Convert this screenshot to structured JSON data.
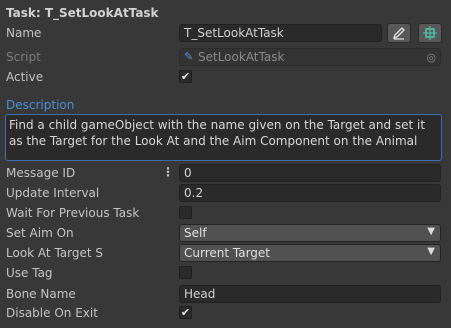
{
  "header": {
    "title": "Task: T_SetLookAtTask"
  },
  "fields": {
    "name": {
      "label": "Name",
      "value": "T_SetLookAtTask"
    },
    "script": {
      "label": "Script",
      "value": "SetLookAtTask"
    },
    "active": {
      "label": "Active",
      "checked": true
    },
    "description": {
      "label": "Description",
      "value": "Find a child gameObject with the name given on the Target and set it as the Target for the Look At and the Aim Component on the Animal"
    },
    "message_id": {
      "label": "Message ID",
      "value": "0"
    },
    "update_interval": {
      "label": "Update Interval",
      "value": "0.2"
    },
    "wait_for_previous": {
      "label": "Wait For Previous Task",
      "checked": false
    },
    "set_aim_on": {
      "label": "Set Aim On",
      "value": "Self"
    },
    "look_at_target": {
      "label": "Look At Target S",
      "value": "Current Target"
    },
    "use_tag": {
      "label": "Use Tag",
      "checked": false
    },
    "bone_name": {
      "label": "Bone Name",
      "value": "Head"
    },
    "disable_on_exit": {
      "label": "Disable On Exit",
      "checked": true
    }
  },
  "icons": {
    "edit": "pencil-icon",
    "ping": "select-object-icon",
    "script": "script-icon",
    "object_picker": "object-picker-icon",
    "dropdown": "chevron-down-icon",
    "options": "kebab-menu-icon"
  },
  "glyphs": {
    "check": "✔",
    "arrow": "▼",
    "dots": "⋮"
  },
  "colors": {
    "accent": "#4c8ed8",
    "background": "#383838",
    "field": "#2a2a2a"
  }
}
